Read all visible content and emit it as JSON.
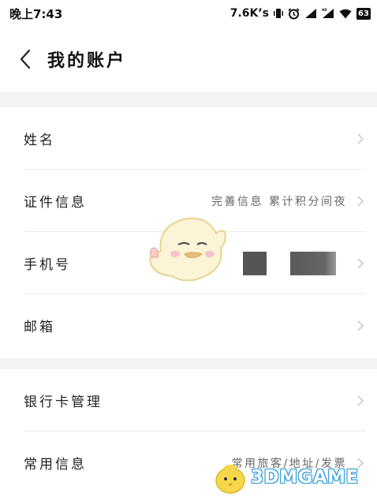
{
  "status_bar": {
    "time": "晚上7:43",
    "net_speed": "7.6K’s",
    "battery": "63"
  },
  "header": {
    "title": "我的账户"
  },
  "account_group": {
    "rows": [
      {
        "label": "姓名",
        "value": ""
      },
      {
        "label": "证件信息",
        "value": "完善信息 累计积分间夜"
      },
      {
        "label": "手机号",
        "value": ""
      },
      {
        "label": "邮箱",
        "value": ""
      }
    ]
  },
  "service_group": {
    "rows": [
      {
        "label": "银行卡管理",
        "value": ""
      },
      {
        "label": "常用信息",
        "value": "常用旅客/地址/发票"
      }
    ]
  },
  "watermark": {
    "text": "3DMGAME"
  },
  "icons": {
    "back": "chevron-left-icon",
    "row_arrow": "chevron-right-icon",
    "signal": "signal-icon",
    "wifi": "wifi-icon",
    "alarm": "alarm-icon",
    "vibrate": "vibrate-icon"
  },
  "colors": {
    "background": "#f3f3f5",
    "surface": "#ffffff",
    "text_primary": "#222222",
    "text_secondary": "#666666",
    "watermark_blue": "#2a9ad8"
  }
}
